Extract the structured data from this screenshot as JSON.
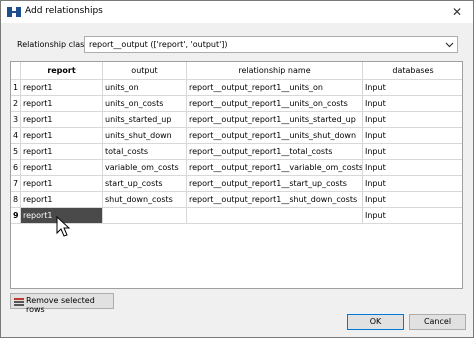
{
  "window": {
    "title": "Add relationships"
  },
  "relationship_class": {
    "label": "Relationship class",
    "value": "report__output (['report', 'output'])"
  },
  "table": {
    "columns": [
      "report",
      "output",
      "relationship name",
      "databases"
    ],
    "rows": [
      {
        "num": "1",
        "report": "report1",
        "output": "units_on",
        "name": "report__output_report1__units_on",
        "db": "Input"
      },
      {
        "num": "2",
        "report": "report1",
        "output": "units_on_costs",
        "name": "report__output_report1__units_on_costs",
        "db": "Input"
      },
      {
        "num": "3",
        "report": "report1",
        "output": "units_started_up",
        "name": "report__output_report1__units_started_up",
        "db": "Input"
      },
      {
        "num": "4",
        "report": "report1",
        "output": "units_shut_down",
        "name": "report__output_report1__units_shut_down",
        "db": "Input"
      },
      {
        "num": "5",
        "report": "report1",
        "output": "total_costs",
        "name": "report__output_report1__total_costs",
        "db": "Input"
      },
      {
        "num": "6",
        "report": "report1",
        "output": "variable_om_costs",
        "name": "report__output_report1__variable_om_costs",
        "db": "Input"
      },
      {
        "num": "7",
        "report": "report1",
        "output": "start_up_costs",
        "name": "report__output_report1__start_up_costs",
        "db": "Input"
      },
      {
        "num": "8",
        "report": "report1",
        "output": "shut_down_costs",
        "name": "report__output_report1__shut_down_costs",
        "db": "Input"
      },
      {
        "num": "9",
        "report": "report1",
        "output": "",
        "name": "",
        "db": "Input"
      }
    ]
  },
  "buttons": {
    "remove_rows": "Remove selected rows",
    "ok": "OK",
    "cancel": "Cancel"
  },
  "colors": {
    "accent": "#0078d7",
    "selected_cell": "#4a4a4a"
  },
  "icons": {
    "app": "relationship-app-icon",
    "close": "close-icon",
    "remove": "remove-rows-icon"
  }
}
